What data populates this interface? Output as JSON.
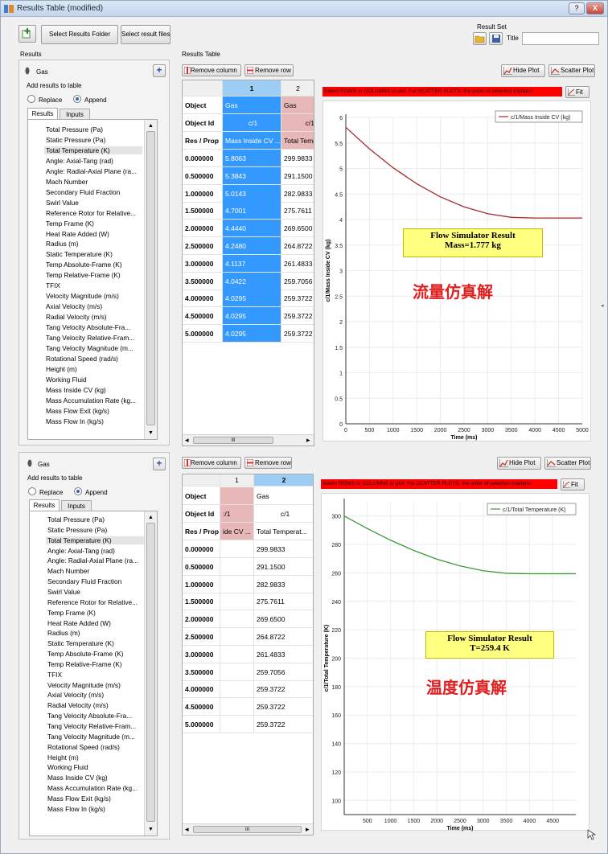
{
  "window": {
    "title": "Results Table (modified)",
    "help_label": "?",
    "close_label": "X"
  },
  "toolbar": {
    "select_results_folder": "Select Results Folder",
    "select_result_files": "Select result files"
  },
  "result_set": {
    "label": "Result Set",
    "title_label": "Title",
    "title_value": ""
  },
  "sections": {
    "results": "Results",
    "results_table": "Results Table"
  },
  "left_panel": {
    "gas_label": "Gas",
    "add_results_label": "Add results to table",
    "replace_label": "Replace",
    "append_label": "Append",
    "tab_results": "Results",
    "tab_inputs": "Inputs",
    "plus_label": "+",
    "selected_item": "Total Temperature (K)",
    "items": [
      "Total Pressure (Pa)",
      "Static Pressure (Pa)",
      "Total Temperature (K)",
      "Angle: Axial-Tang (rad)",
      "Angle: Radial-Axial Plane (ra...",
      "Mach Number",
      "Secondary Fluid Fraction",
      "Swirl Value",
      "Reference Rotor for Relative...",
      "Temp Frame (K)",
      "Heat Rate Added (W)",
      "Radius (m)",
      "Static Temperature (K)",
      "Temp Absolute-Frame (K)",
      "Temp Relative-Frame (K)",
      "TFIX",
      "Velocity Magnitude (m/s)",
      "Axial Velocity (m/s)",
      "Radial Velocity (m/s)",
      "Tang Velocity Absolute-Fra...",
      "Tang Velocity Relative-Fram...",
      "Tang Velocity Magnitude (m...",
      "Rotational Speed (rad/s)",
      "Height (m)",
      "Working Fluid",
      "Mass Inside CV (kg)",
      "Mass Accumulation Rate (kg...",
      "Mass Flow Exit (kg/s)",
      "Mass Flow In (kg/s)"
    ]
  },
  "table_toolbar": {
    "remove_column": "Remove column",
    "remove_row": "Remove row",
    "hide_plot": "Hide Plot",
    "scatter_plot": "Scatter Plot",
    "fit": "Fit"
  },
  "instruction_bar": "Select ROWS or COLUMNS to plot. For SCATTER PLOTS, the order of selection matters!",
  "table1": {
    "col_headers": [
      "1",
      "2"
    ],
    "row_labels": [
      "Object",
      "Object Id",
      "Res / Prop"
    ],
    "col1_meta": [
      "Gas",
      "c/1",
      "Mass Inside CV ..."
    ],
    "col2_meta": [
      "Gas",
      "c/1",
      "Total Temp"
    ],
    "rows": [
      "0.000000",
      "0.500000",
      "1.000000",
      "1.500000",
      "2.000000",
      "2.500000",
      "3.000000",
      "3.500000",
      "4.000000",
      "4.500000",
      "5.000000"
    ],
    "col1": [
      "5.8063",
      "5.3843",
      "5.0143",
      "4.7001",
      "4.4440",
      "4.2480",
      "4.1137",
      "4.0422",
      "4.0295",
      "4.0295",
      "4.0295"
    ],
    "col2": [
      "299.9833",
      "291.1500",
      "282.9833",
      "275.7611",
      "269.6500",
      "264.8722",
      "261.4833",
      "259.7056",
      "259.3722",
      "259.3722",
      "259.3722"
    ]
  },
  "table2": {
    "col_headers": [
      "1",
      "2"
    ],
    "col1_meta": [
      "",
      ":/1",
      "ide CV ..."
    ],
    "col2_meta": [
      "Gas",
      "c/1",
      "Total Temperat..."
    ]
  },
  "scroll_labels": {
    "left": "◂",
    "right": "▸",
    "grip": "III"
  },
  "chart_data": [
    {
      "type": "line",
      "legend": "c/1/Mass Inside CV (kg)",
      "legend_position": "top-right",
      "xlabel": "Time (ms)",
      "ylabel": "c/1/Mass Inside CV (kg)",
      "xlim": [
        0,
        5000
      ],
      "ylim": [
        0,
        6.0
      ],
      "xticks": [
        "0",
        "500",
        "1000",
        "1500",
        "2000",
        "2500",
        "3000",
        "3500",
        "4000",
        "4500",
        "5000"
      ],
      "yticks": [
        "0",
        "0.5",
        "1",
        "1.5",
        "2",
        "2.5",
        "3",
        "3.5",
        "4",
        "4.5",
        "5",
        "5.5",
        "6"
      ],
      "x": [
        0,
        500,
        1000,
        1500,
        2000,
        2500,
        3000,
        3500,
        4000,
        4500,
        5000
      ],
      "y": [
        5.8063,
        5.3843,
        5.0143,
        4.7001,
        4.444,
        4.248,
        4.1137,
        4.0422,
        4.0295,
        4.0295,
        4.0295
      ],
      "color": "#a52a2a",
      "grid": true,
      "annotation": [
        "Flow Simulator Result",
        "Mass=1.777 kg"
      ],
      "cjk_note": "流量仿真解"
    },
    {
      "type": "line",
      "legend": "c/1/Total Temperature (K)",
      "legend_position": "top-right",
      "xlabel": "Time (ms)",
      "ylabel": "c/1/Total Temperature (K)",
      "xlim": [
        0,
        5000
      ],
      "ylim": [
        90,
        310
      ],
      "xticks": [
        "500",
        "1000",
        "1500",
        "2000",
        "2500",
        "3000",
        "3500",
        "4000",
        "4500"
      ],
      "yticks": [
        "100",
        "120",
        "140",
        "160",
        "180",
        "200",
        "220",
        "240",
        "260",
        "280",
        "300"
      ],
      "x": [
        0,
        500,
        1000,
        1500,
        2000,
        2500,
        3000,
        3500,
        4000,
        4500,
        5000
      ],
      "y": [
        299.9833,
        291.15,
        282.9833,
        275.7611,
        269.65,
        264.8722,
        261.4833,
        259.7056,
        259.3722,
        259.3722,
        259.3722
      ],
      "color": "#3a9a3a",
      "grid": true,
      "annotation": [
        "Flow Simulator Result",
        "T=259.4 K"
      ],
      "cjk_note": "温度仿真解"
    }
  ]
}
